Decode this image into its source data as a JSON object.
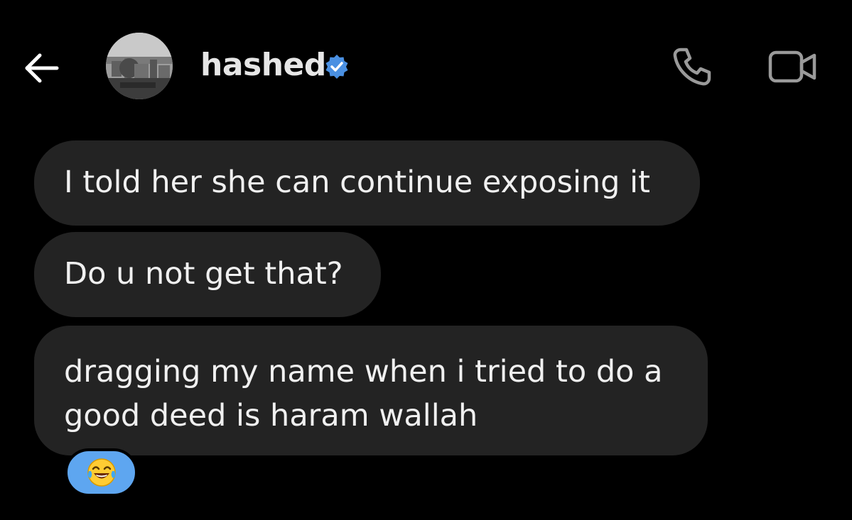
{
  "header": {
    "contact_name": "hashed",
    "verified_icon": "verified-badge-icon",
    "back_icon": "back-arrow-icon",
    "call_icon": "phone-icon",
    "video_icon": "video-camera-icon"
  },
  "messages": [
    {
      "text": "I told her she can continue exposing it"
    },
    {
      "text": "Do u not get that?"
    },
    {
      "text": "dragging my name when i tried to do a good deed is haram wallah"
    }
  ],
  "reaction": {
    "emoji": "😂",
    "icon": "face-with-tears-of-joy-icon"
  },
  "colors": {
    "background": "#000000",
    "bubble": "#232323",
    "verified": "#4a90e2",
    "reaction_pill": "#5ea6f0"
  }
}
